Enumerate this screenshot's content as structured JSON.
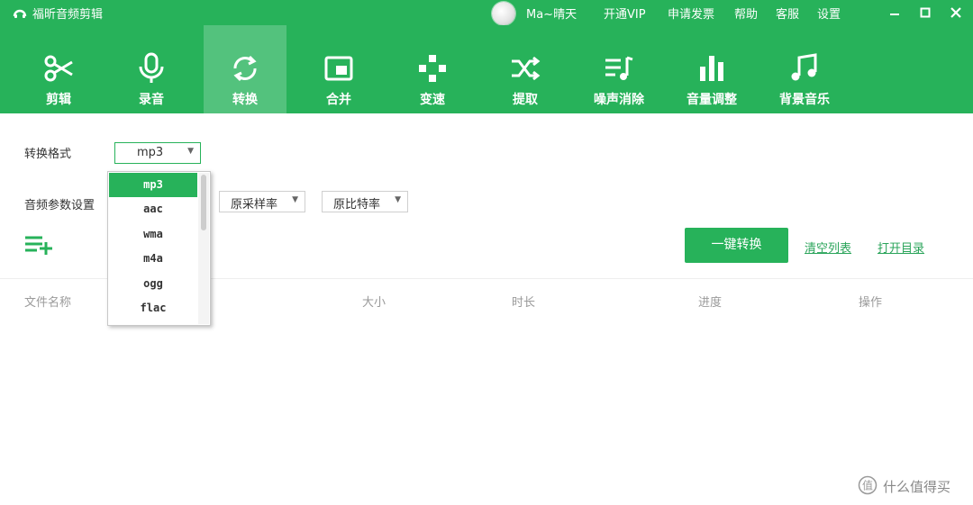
{
  "app": {
    "title": "福昕音频剪辑"
  },
  "user": {
    "name": "Ma~晴天"
  },
  "top_menu": [
    {
      "label": "开通VIP"
    },
    {
      "label": "申请发票"
    },
    {
      "label": "帮助"
    },
    {
      "label": "客服"
    },
    {
      "label": "设置"
    }
  ],
  "window_controls": {
    "minimize": "minimize-icon",
    "maximize": "maximize-icon",
    "close": "close-icon"
  },
  "toolbar": [
    {
      "label": "剪辑",
      "icon": "scissors-icon"
    },
    {
      "label": "录音",
      "icon": "microphone-icon"
    },
    {
      "label": "转换",
      "icon": "convert-icon",
      "active": true
    },
    {
      "label": "合并",
      "icon": "merge-icon"
    },
    {
      "label": "变速",
      "icon": "speed-icon"
    },
    {
      "label": "提取",
      "icon": "extract-icon"
    },
    {
      "label": "噪声消除",
      "icon": "noise-removal-icon"
    },
    {
      "label": "音量调整",
      "icon": "volume-icon"
    },
    {
      "label": "背景音乐",
      "icon": "music-note-icon"
    }
  ],
  "convert": {
    "format_label": "转换格式",
    "format_value": "mp3",
    "params_label": "音频参数设置",
    "sample_rate": "原采样率",
    "bit_rate": "原比特率",
    "format_options": [
      "mp3",
      "aac",
      "wma",
      "m4a",
      "ogg",
      "flac"
    ],
    "selected_option": "mp3"
  },
  "actions": {
    "convert_button": "一键转换",
    "clear_list": "清空列表",
    "open_dir": "打开目录"
  },
  "table": {
    "columns": [
      "文件名称",
      "大小",
      "时长",
      "进度",
      "操作"
    ]
  },
  "watermark": {
    "text": "什么值得买"
  },
  "colors": {
    "brand": "#27b25a",
    "active_tab": "#53c27d",
    "link": "#2aa45a"
  }
}
